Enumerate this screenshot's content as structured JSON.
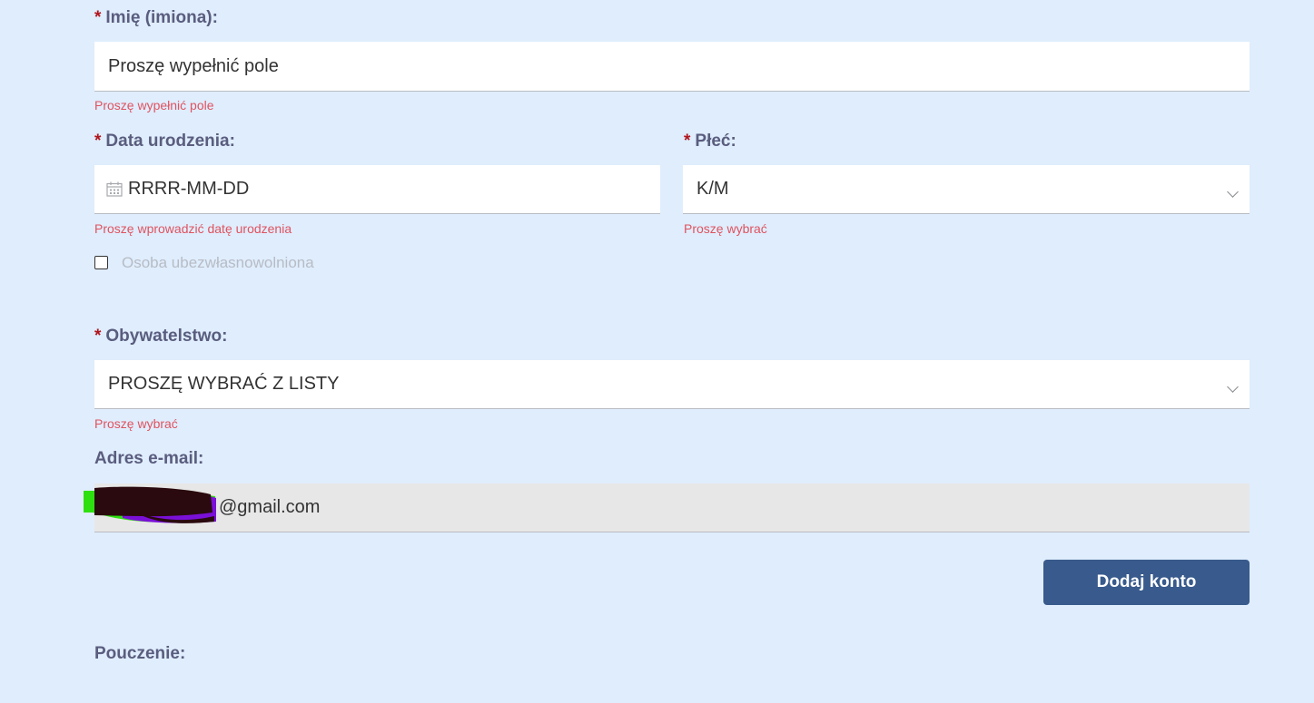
{
  "form": {
    "required_marker": "*",
    "first_name": {
      "label": "Imię (imiona):",
      "value": "Proszę wypełnić pole",
      "error": "Proszę wypełnić pole"
    },
    "birth_date": {
      "label": "Data urodzenia:",
      "placeholder": "RRRR-MM-DD",
      "error": "Proszę wprowadzić datę urodzenia"
    },
    "gender": {
      "label": "Płeć:",
      "selected": "K/M",
      "error": "Proszę wybrać"
    },
    "incapacitated": {
      "label": "Osoba ubezwłasnowolniona",
      "checked": false
    },
    "citizenship": {
      "label": "Obywatelstwo:",
      "selected": "PROSZĘ WYBRAĆ Z LISTY",
      "error": "Proszę wybrać"
    },
    "email": {
      "label": "Adres e-mail:",
      "value_visible": "@gmail.com"
    },
    "submit_label": "Dodaj konto",
    "instructions_heading": "Pouczenie:"
  },
  "colors": {
    "background": "#dfedfd",
    "label": "#5a5d7e",
    "required": "#b0151c",
    "error": "#e0535f",
    "button": "#385a8c",
    "disabled_field": "#e7e7e7"
  }
}
